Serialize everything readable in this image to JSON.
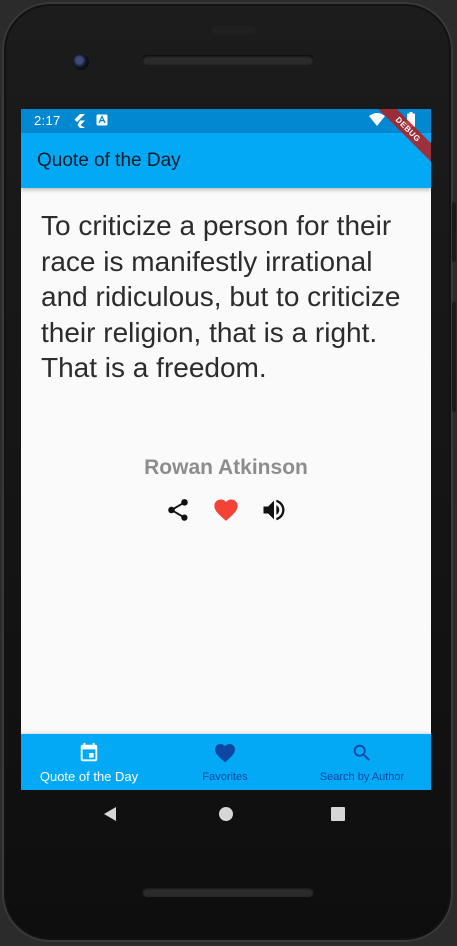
{
  "status_bar": {
    "time": "2:17"
  },
  "debug_banner": "DEBUG",
  "app_bar": {
    "title": "Quote of the Day"
  },
  "quote": {
    "text": "To criticize a person for their race is manifestly irrational and ridiculous, but to criticize their religion, that is a right. That is a freedom.",
    "author": "Rowan Atkinson"
  },
  "actions": [
    {
      "icon": "share-icon"
    },
    {
      "icon": "heart-icon",
      "color": "#f44336"
    },
    {
      "icon": "volume-icon"
    }
  ],
  "bottom_nav": {
    "items": [
      {
        "label": "Quote of the Day",
        "icon": "calendar-icon",
        "active": true
      },
      {
        "label": "Favorites",
        "icon": "heart-icon",
        "active": false
      },
      {
        "label": "Search by Author",
        "icon": "search-icon",
        "active": false
      }
    ]
  },
  "colors": {
    "app_bar": "#03a9f4",
    "status_bar": "#0288d1",
    "nav_inactive": "#0d47a1",
    "heart": "#f44336",
    "author": "#8d8d8d"
  }
}
